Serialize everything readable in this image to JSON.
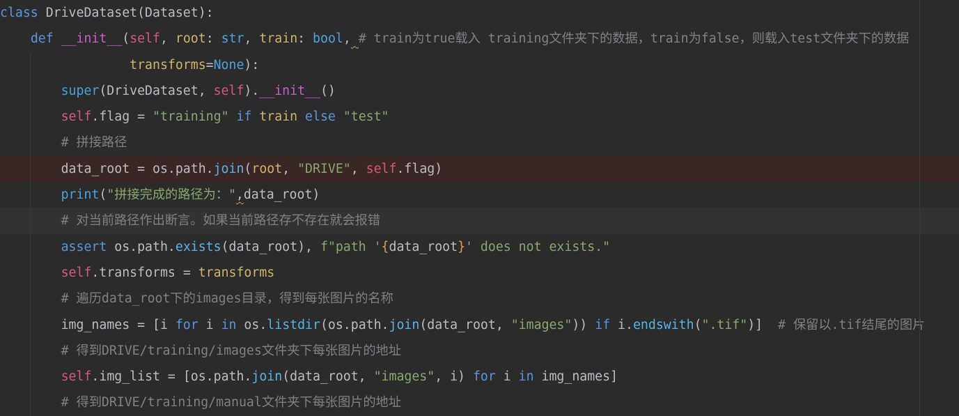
{
  "colors": {
    "background": "#2b2b2b",
    "plain": "#bcbec4",
    "keyword": "#5b95df",
    "builtin": "#4ea3dd",
    "function": "#56b5e8",
    "self": "#d7587b",
    "magic_method": "#cc5bd2",
    "parameter": "#d1b46b",
    "string": "#87a96e",
    "brace": "#d89f4d",
    "comment": "#7e8186",
    "warning": "#b9a46a",
    "breakpoint_line": "#3b2626",
    "current_line": "#323232",
    "guide": "#393939"
  },
  "editor": {
    "lines": [
      {
        "tokens": [
          {
            "keyword": "class"
          },
          {
            "plain": " DriveDataset(Dataset):"
          }
        ]
      },
      {
        "tokens": [
          {
            "plain": "    "
          },
          {
            "keyword": "def"
          },
          {
            "plain": " "
          },
          {
            "magic_method": "__init__"
          },
          {
            "plain": "("
          },
          {
            "self": "self"
          },
          {
            "plain": ", "
          },
          {
            "parameter": "root"
          },
          {
            "plain": ": "
          },
          {
            "builtin": "str"
          },
          {
            "plain": ", "
          },
          {
            "parameter": "train"
          },
          {
            "plain": ": "
          },
          {
            "builtin": "bool"
          },
          {
            "plain": ","
          },
          {
            "plain": " ",
            "warning": true
          },
          {
            "comment": "# train为true载入 training文件夹下的数据，train为false，则载入test文件夹下的数据"
          }
        ]
      },
      {
        "tokens": [
          {
            "plain": "                 "
          },
          {
            "parameter": "transforms"
          },
          {
            "plain": "="
          },
          {
            "builtin": "None"
          },
          {
            "plain": "):"
          }
        ]
      },
      {
        "tokens": [
          {
            "plain": "        "
          },
          {
            "builtin": "super"
          },
          {
            "plain": "(DriveDataset, "
          },
          {
            "self": "self"
          },
          {
            "plain": ")."
          },
          {
            "magic_method": "__init__"
          },
          {
            "plain": "()"
          }
        ]
      },
      {
        "tokens": [
          {
            "plain": "        "
          },
          {
            "self": "self"
          },
          {
            "plain": ".flag = "
          },
          {
            "string": "\"training\""
          },
          {
            "plain": " "
          },
          {
            "keyword": "if"
          },
          {
            "plain": " "
          },
          {
            "parameter": "train"
          },
          {
            "plain": " "
          },
          {
            "keyword": "else"
          },
          {
            "plain": " "
          },
          {
            "string": "\"test\""
          }
        ]
      },
      {
        "tokens": [
          {
            "plain": "        "
          },
          {
            "comment": "# 拼接路径"
          }
        ]
      },
      {
        "breakpoint": true,
        "tokens": [
          {
            "plain": "        data_root = os.path."
          },
          {
            "function": "join"
          },
          {
            "plain": "("
          },
          {
            "parameter": "root"
          },
          {
            "plain": ", "
          },
          {
            "string": "\"DRIVE\""
          },
          {
            "plain": ", "
          },
          {
            "self": "self"
          },
          {
            "plain": ".flag)"
          }
        ]
      },
      {
        "tokens": [
          {
            "plain": "        "
          },
          {
            "builtin": "print"
          },
          {
            "plain": "("
          },
          {
            "string": "\"拼接完成的路径为：\""
          },
          {
            "plain": ",",
            "warning": true
          },
          {
            "plain": "data_root)"
          }
        ]
      },
      {
        "current": true,
        "tokens": [
          {
            "plain": "        "
          },
          {
            "comment": "# 对当前路径作出断言。如果当前路径存不存在就会报错"
          }
        ]
      },
      {
        "tokens": [
          {
            "plain": "        "
          },
          {
            "keyword": "assert"
          },
          {
            "plain": " os.path."
          },
          {
            "function": "exists"
          },
          {
            "plain": "(data_root), "
          },
          {
            "string": "f\"path '"
          },
          {
            "brace": "{"
          },
          {
            "plain": "data_root"
          },
          {
            "brace": "}"
          },
          {
            "string": "' does not exists.\""
          }
        ]
      },
      {
        "tokens": [
          {
            "plain": "        "
          },
          {
            "self": "self"
          },
          {
            "plain": ".transforms = "
          },
          {
            "parameter": "transforms"
          }
        ]
      },
      {
        "tokens": [
          {
            "plain": "        "
          },
          {
            "comment": "# 遍历data_root下的images目录，得到每张图片的名称"
          }
        ]
      },
      {
        "tokens": [
          {
            "plain": "        img_names = [i "
          },
          {
            "keyword": "for"
          },
          {
            "plain": " i "
          },
          {
            "keyword": "in"
          },
          {
            "plain": " os."
          },
          {
            "function": "listdir"
          },
          {
            "plain": "(os.path."
          },
          {
            "function": "join"
          },
          {
            "plain": "(data_root, "
          },
          {
            "string": "\"images\""
          },
          {
            "plain": ")) "
          },
          {
            "keyword": "if"
          },
          {
            "plain": " i."
          },
          {
            "function": "endswith"
          },
          {
            "plain": "("
          },
          {
            "string": "\".tif\""
          },
          {
            "plain": ")]  "
          },
          {
            "comment": "# 保留以.tif结尾的图片"
          }
        ]
      },
      {
        "tokens": [
          {
            "plain": "        "
          },
          {
            "comment": "# 得到DRIVE/training/images文件夹下每张图片的地址"
          }
        ]
      },
      {
        "tokens": [
          {
            "plain": "        "
          },
          {
            "self": "self"
          },
          {
            "plain": ".img_list = [os.path."
          },
          {
            "function": "join"
          },
          {
            "plain": "(data_root, "
          },
          {
            "string": "\"images\""
          },
          {
            "plain": ", i) "
          },
          {
            "keyword": "for"
          },
          {
            "plain": " i "
          },
          {
            "keyword": "in"
          },
          {
            "plain": " img_names]"
          }
        ]
      },
      {
        "tokens": [
          {
            "plain": "        "
          },
          {
            "comment": "# 得到DRIVE/training/manual文件夹下每张图片的地址"
          }
        ]
      }
    ]
  }
}
